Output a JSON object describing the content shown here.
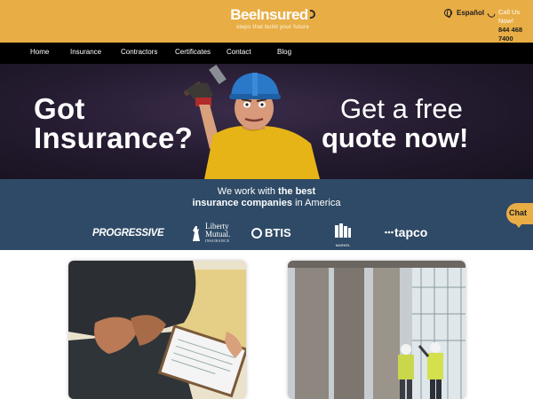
{
  "header": {
    "logo_bee": "Bee",
    "logo_insured": "Insured",
    "tagline": "steps that build your future",
    "language": "Español",
    "call_label": "Call Us Now!",
    "phone": "844 468 7400"
  },
  "nav": {
    "items": [
      "Home",
      "Insurance",
      "Contractors",
      "Certificates",
      "Contact",
      "Blog"
    ]
  },
  "hero": {
    "left_line1": "Got",
    "left_line2": "Insurance?",
    "right_line1": "Get a free",
    "right_line2": "quote now!"
  },
  "partners": {
    "line1_pre": "We work with ",
    "line1_bold": "the best",
    "line2_bold": "insurance companies",
    "line2_post": " in America",
    "logos": {
      "progressive": "PROGRESSIVE",
      "liberty_1": "Liberty",
      "liberty_2": "Mutual.",
      "liberty_sub": "INSURANCE",
      "btis": "BTIS",
      "markel": "MARKEL",
      "tapco": "tapco"
    }
  },
  "chat": {
    "label": "Chat"
  },
  "colors": {
    "brand_yellow": "#e8ad45",
    "nav_black": "#000000",
    "band_blue": "#2e4a66",
    "hero_dark": "#231a2e"
  },
  "images": {
    "card1": "person-holding-clipboard-photo",
    "card2": "construction-workers-site-photo"
  }
}
